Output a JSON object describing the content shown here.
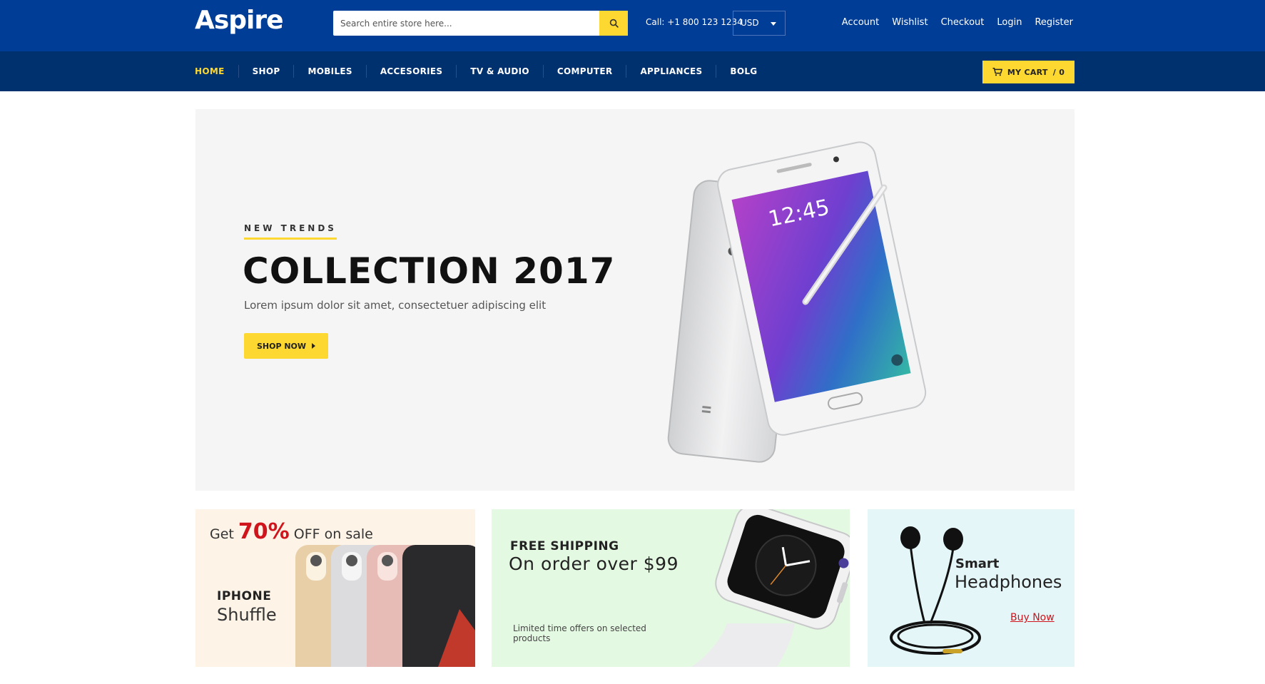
{
  "header": {
    "logo": "Aspire",
    "search_placeholder": "Search entire store here...",
    "call": "Call: +1 800 123 1234",
    "currency": "USD",
    "links": [
      "Account",
      "Wishlist",
      "Checkout",
      "Login",
      "Register"
    ]
  },
  "nav": {
    "items": [
      "HOME",
      "SHOP",
      "MOBILES",
      "ACCESORIES",
      "TV & AUDIO",
      "COMPUTER",
      "APPLIANCES",
      "BOLG"
    ],
    "active": "HOME",
    "cart_label": "MY CART",
    "cart_count": "/ 0"
  },
  "hero": {
    "eyebrow": "NEW TRENDS",
    "title": "COLLECTION 2017",
    "subtitle": "Lorem ipsum dolor sit amet, consectetuer adipiscing elit",
    "button": "SHOP NOW",
    "phone_time": "12:45"
  },
  "promos": {
    "p1": {
      "prefix": "Get",
      "percent": "70%",
      "suffix": "OFF on sale",
      "title": "IPHONE",
      "subtitle": "Shuffle"
    },
    "p2": {
      "title": "FREE SHIPPING",
      "subtitle": "On order over $99",
      "note": "Limited time offers on selected products"
    },
    "p3": {
      "title": "Smart",
      "subtitle": "Headphones",
      "link": "Buy Now"
    }
  },
  "colors": {
    "topbar": "#003d96",
    "navbar": "#00316f",
    "accent": "#fdd831",
    "sale_red": "#d0141c"
  }
}
